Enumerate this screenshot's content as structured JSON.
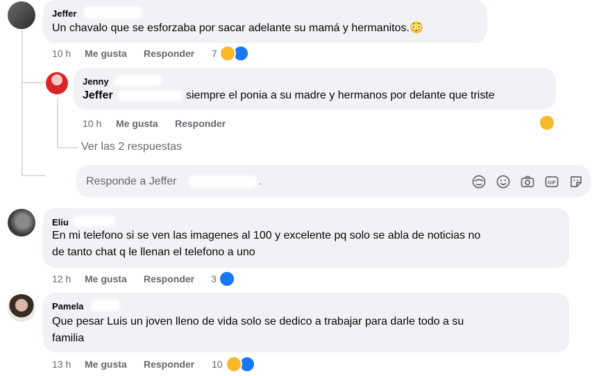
{
  "comments": [
    {
      "author": "Jeffer",
      "text": "Un chavalo que se esforzaba por sacar adelante su mamá y hermanitos.",
      "emoji": "😳",
      "time": "10 h",
      "like_label": "Me gusta",
      "reply_label": "Responder",
      "reaction_count": "7"
    },
    {
      "author": "Jenny",
      "mention": "Jeffer",
      "text": "siempre el ponia a su madre y hermanos por delante que triste",
      "time": "10 h",
      "like_label": "Me gusta",
      "reply_label": "Responder"
    },
    {
      "author": "Eliu",
      "text_line1": "En mi telefono si se ven las imagenes al 100 y excelente pq solo se abla de noticias no",
      "text_line2": "de tanto chat q le llenan el telefono a uno",
      "time": "12 h",
      "like_label": "Me gusta",
      "reply_label": "Responder",
      "reaction_count": "3"
    },
    {
      "author": "Pamela",
      "text_line1": "Que pesar Luis un joven lleno de vida solo se dedico a trabajar para darle todo a su",
      "text_line2": "familia",
      "time": "13 h",
      "like_label": "Me gusta",
      "reply_label": "Responder",
      "reaction_count": "10"
    }
  ],
  "view_replies": "Ver las 2 respuestas",
  "reply_input": {
    "placeholder": "Responde a Jeffer",
    "suffix": "."
  },
  "colors": {
    "bubble": "#f0f2f5",
    "meta": "#65676b",
    "like": "#1877f2",
    "sad": "#f7b928"
  },
  "icons": [
    "avatar-emoji-icon",
    "smiley-icon",
    "camera-icon",
    "gif-icon",
    "sticker-icon",
    "like-reaction-icon",
    "sad-reaction-icon"
  ]
}
